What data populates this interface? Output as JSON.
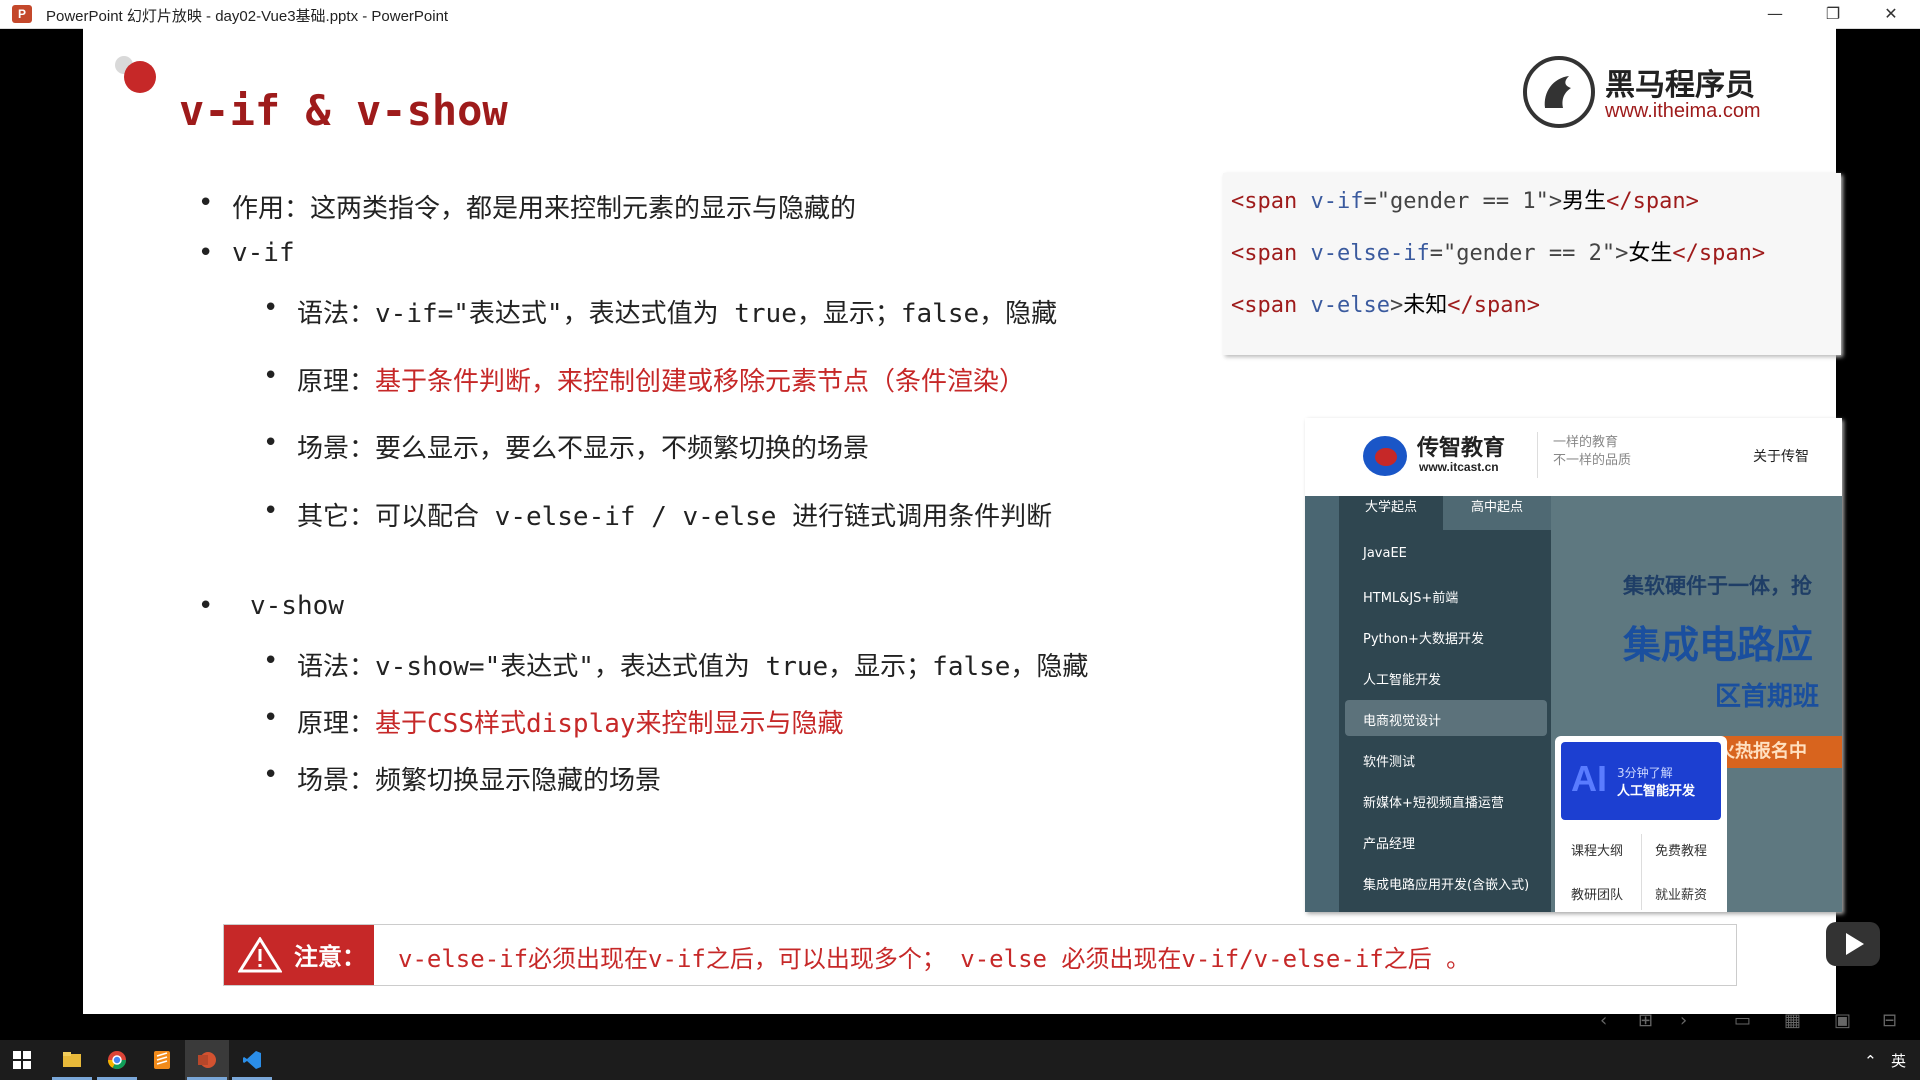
{
  "window": {
    "app_icon": "P",
    "title": "PowerPoint 幻灯片放映 - day02-Vue3基础.pptx - PowerPoint",
    "minimize_icon": "minimize-icon",
    "restore_icon": "restore-icon",
    "close_icon": "close-icon"
  },
  "slide": {
    "title": "v-if & v-show",
    "logo": {
      "cn": "黑马程序员",
      "url": "www.itheima.com"
    },
    "bullets": [
      {
        "text": "作用：这两类指令，都是用来控制元素的显示与隐藏的"
      },
      {
        "text": "v-if"
      }
    ],
    "vif_sub": [
      {
        "label": "语法：",
        "text": "v-if=\"表达式\"，表达式值为 true，显示；false，隐藏"
      },
      {
        "label": "原理：",
        "text": "基于条件判断，来控制创建或移除元素节点（条件渲染）"
      },
      {
        "label": "场景：",
        "text": "要么显示，要么不显示，不频繁切换的场景"
      },
      {
        "label": "其它：",
        "text": "可以配合 v-else-if / v-else 进行链式调用条件判断"
      }
    ],
    "vshow_title": "v-show",
    "vshow_sub": [
      {
        "label": "语法：",
        "text": "v-show=\"表达式\"，表达式值为 true，显示；false，隐藏"
      },
      {
        "label": "原理：",
        "text": "基于CSS样式display来控制显示与隐藏"
      },
      {
        "label": "场景：",
        "text": "频繁切换显示隐藏的场景"
      }
    ],
    "code": {
      "line1": {
        "open": "<span ",
        "attr": "v-if",
        "eq": "=\"gender == 1\">",
        "content": "男生",
        "close": "</span>"
      },
      "line2": {
        "open": "<span ",
        "attr": "v-else-if",
        "eq": "=\"gender == 2\">",
        "content": "女生",
        "close": "</span>"
      },
      "line3": {
        "open": "<span ",
        "attr": "v-else",
        "eq": ">",
        "content": "未知",
        "close": "</span>"
      }
    },
    "screenshot": {
      "brand": "传智教育",
      "url": "www.itcast.cn",
      "slogan1": "一样的教育",
      "slogan2": "不一样的品质",
      "about": "关于传智",
      "tabs": [
        "大学起点",
        "高中起点"
      ],
      "menu": [
        "JavaEE",
        "HTML&JS+前端",
        "Python+大数据开发",
        "人工智能开发",
        "电商视觉设计",
        "软件测试",
        "新媒体+短视频直播运营",
        "产品经理",
        "集成电路应用开发(含嵌入式)"
      ],
      "banner1": "集软硬件于一体，抢",
      "banner2": "集成电路应",
      "banner3": "区首期班",
      "banner4": "火热报名中",
      "popup_ai": "AI",
      "popup_small": "3分钟了解",
      "popup_big": "人工智能开发",
      "popup_links": [
        "课程大纲",
        "免费教程",
        "教研团队",
        "就业薪资"
      ]
    },
    "note": {
      "label": "注意：",
      "text": "v-else-if必须出现在v-if之后，可以出现多个； v-else 必须出现在v-if/v-else-if之后 。"
    }
  },
  "controls": [
    "‹",
    "⊞",
    "›",
    "▭",
    "▦",
    "▣",
    "⊟"
  ],
  "taskbar": {
    "apps": [
      "start-icon",
      "explorer-icon",
      "chrome-icon",
      "sublime-icon",
      "powerpoint-icon",
      "vscode-icon"
    ],
    "tray_text": "英"
  },
  "colors": {
    "accent_red": "#c62828",
    "title_red": "#9e1b1b",
    "code_attr": "#3a5a9e"
  }
}
